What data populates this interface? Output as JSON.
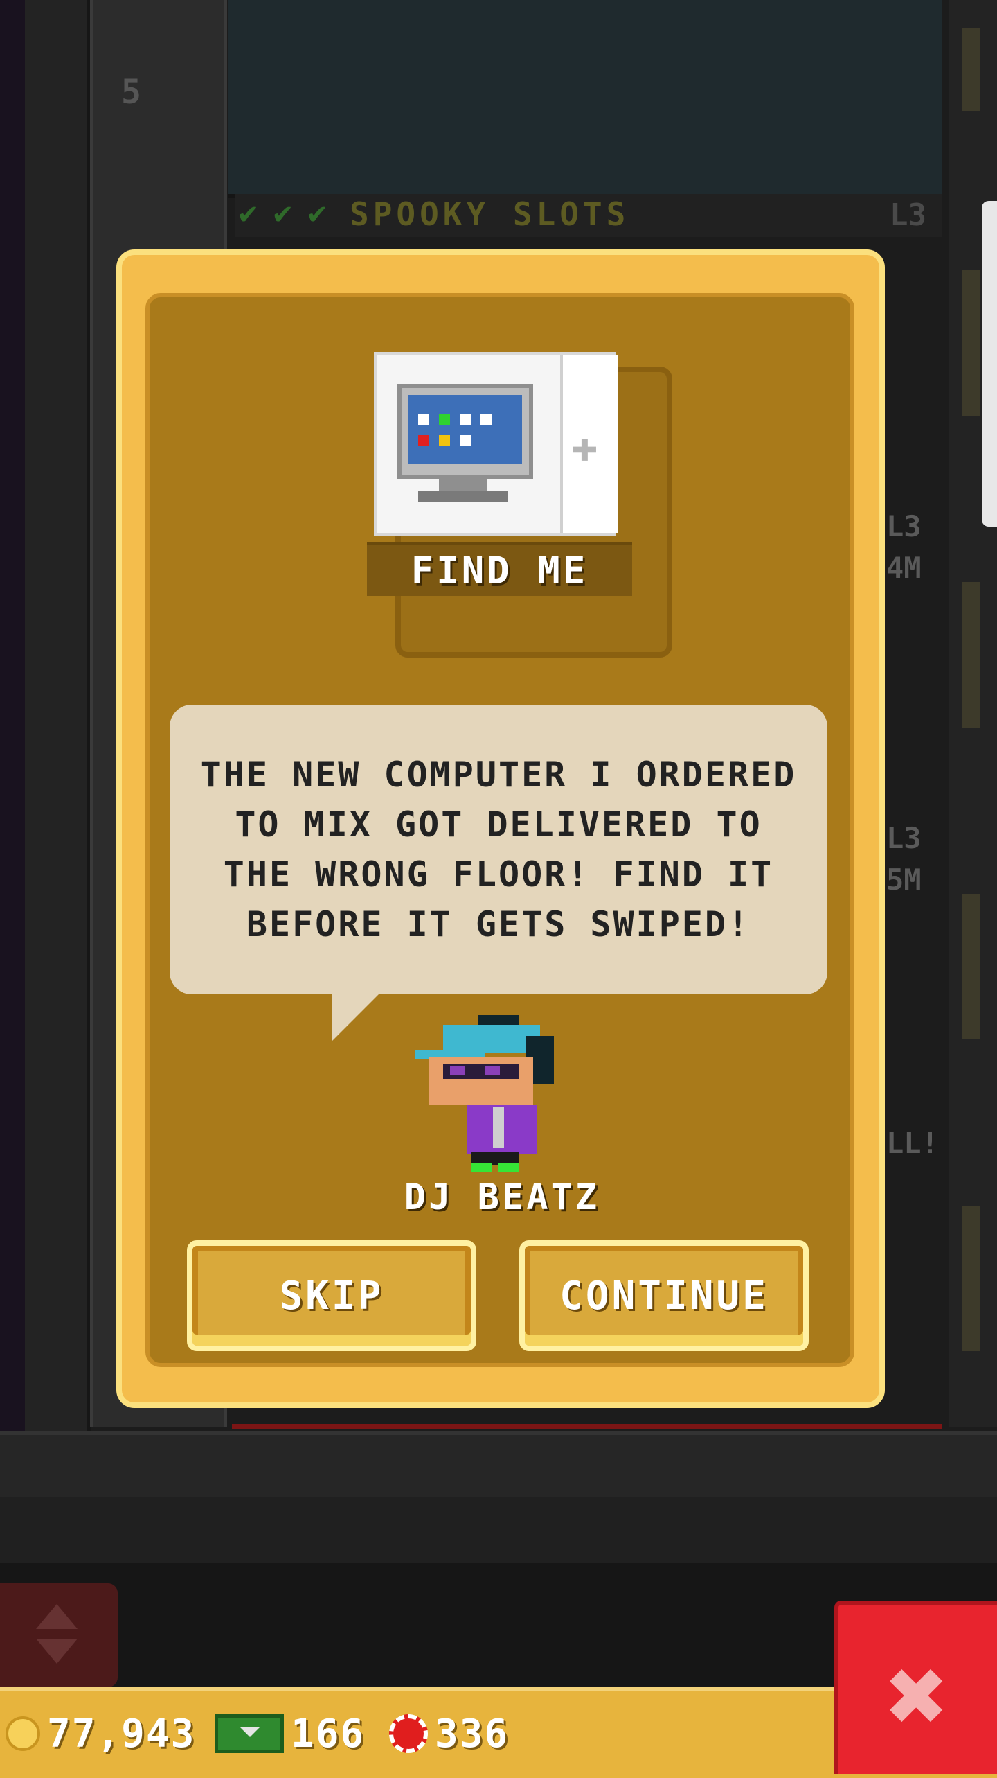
{
  "background": {
    "floor_number": "5",
    "floor_name": "SPOOKY SLOTS",
    "floor_level": "L3",
    "floor_checks": 3,
    "side_tags": [
      "L3",
      "4M",
      "L3",
      "5M",
      "LL!"
    ]
  },
  "dialog": {
    "item": {
      "label": "FIND ME",
      "image_icon": "computer-icon"
    },
    "message": "THE NEW COMPUTER I ORDERED TO MIX GOT DELIVERED TO THE WRONG FLOOR! FIND IT BEFORE IT GETS SWIPED!",
    "character_name": "DJ BEATZ",
    "skip_label": "SKIP",
    "continue_label": "CONTINUE"
  },
  "status_bar": {
    "coins": "77,943",
    "bux": "166",
    "chips": "336"
  },
  "colors": {
    "dialog_frame": "#f4bd4c",
    "dialog_inner": "#a97a1a",
    "speech_bubble": "#e4d6bb",
    "close_button": "#e8242e",
    "status_bar": "#e7b43d"
  }
}
